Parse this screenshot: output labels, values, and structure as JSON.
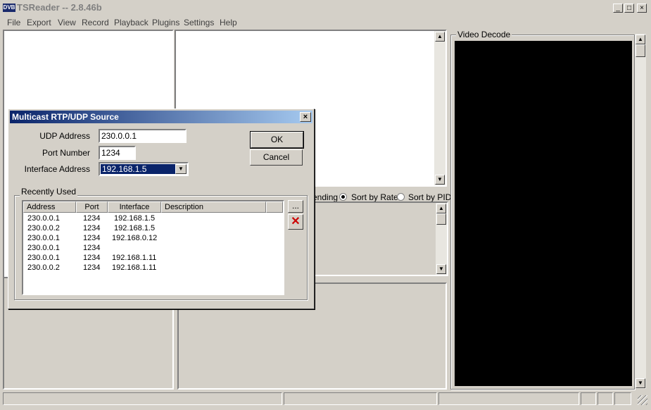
{
  "app": {
    "logo": "DVB",
    "title": "TSReader -- 2.8.46b",
    "window_buttons": {
      "minimize": "_",
      "maximize": "□",
      "close": "×"
    }
  },
  "menu": [
    "File",
    "Export",
    "View",
    "Record",
    "Playback",
    "Plugins",
    "Settings",
    "Help"
  ],
  "video": {
    "group_label": "Video Decode"
  },
  "sort": {
    "ending_text": "ending",
    "by_rate": "Sort by Rate",
    "by_pid": "Sort by PID",
    "selected": "by_rate"
  },
  "dialog": {
    "title": "Multicast RTP/UDP Source",
    "close": "×",
    "udp_label": "UDP Address",
    "udp_value": "230.0.0.1",
    "port_label": "Port Number",
    "port_value": "1234",
    "iface_label": "Interface Address",
    "iface_value": "192.168.1.5",
    "ok": "OK",
    "cancel": "Cancel",
    "recent_label": "Recently Used",
    "browse": "...",
    "columns": [
      "Address",
      "Port",
      "Interface",
      "Description"
    ],
    "rows": [
      [
        "230.0.0.1",
        "1234",
        "192.168.1.5",
        ""
      ],
      [
        "230.0.0.2",
        "1234",
        "192.168.1.5",
        ""
      ],
      [
        "230.0.0.1",
        "1234",
        "192.168.0.12",
        ""
      ],
      [
        "230.0.0.1",
        "1234",
        "",
        ""
      ],
      [
        "230.0.0.1",
        "1234",
        "192.168.1.11",
        ""
      ],
      [
        "230.0.0.2",
        "1234",
        "192.168.1.11",
        ""
      ]
    ]
  },
  "icons": {
    "scroll_up": "▲",
    "scroll_down": "▼",
    "dropdown": "▼",
    "delete": "✕"
  },
  "colors": {
    "title_active": "#0a246a",
    "selection": "#0a246a",
    "delete_red": "#cc0000",
    "video_bg": "#000000"
  }
}
